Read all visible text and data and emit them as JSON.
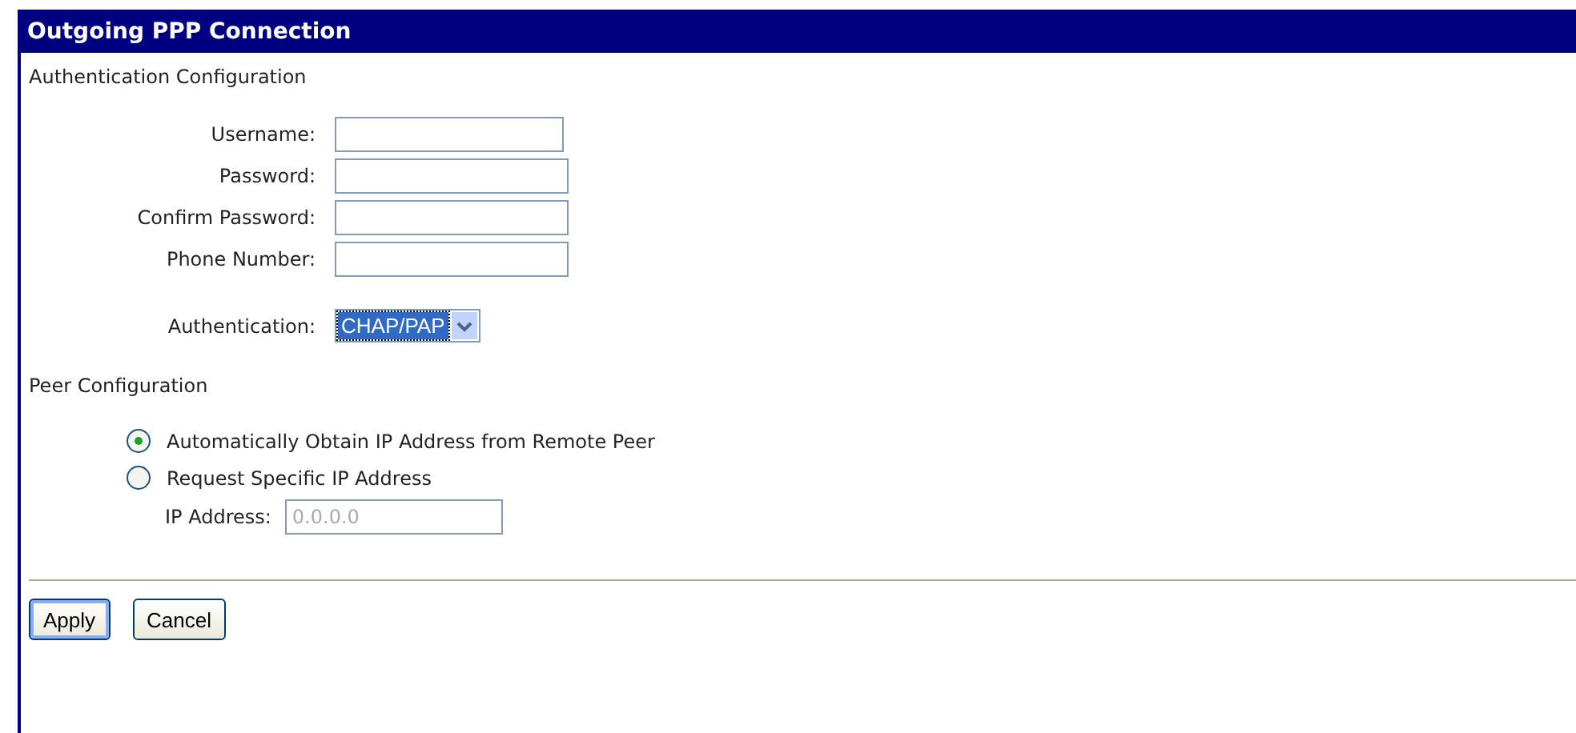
{
  "header": {
    "title": "Outgoing PPP Connection"
  },
  "auth_section": {
    "heading": "Authentication Configuration",
    "fields": [
      {
        "label": "Username:"
      },
      {
        "label": "Password:"
      },
      {
        "label": "Confirm Password:"
      },
      {
        "label": "Phone Number:"
      }
    ],
    "authentication": {
      "label": "Authentication:",
      "value": "CHAP/PAP",
      "focused": true
    }
  },
  "peer_section": {
    "heading": "Peer Configuration",
    "options": [
      {
        "label": "Automatically Obtain IP Address from Remote Peer",
        "selected": true
      },
      {
        "label": "Request Specific IP Address",
        "selected": false
      }
    ],
    "ip_field": {
      "label": "IP Address:",
      "value": "0.0.0.0",
      "disabled": true
    }
  },
  "buttons": [
    {
      "label": "Apply",
      "focused": true
    },
    {
      "label": "Cancel",
      "focused": false
    }
  ]
}
